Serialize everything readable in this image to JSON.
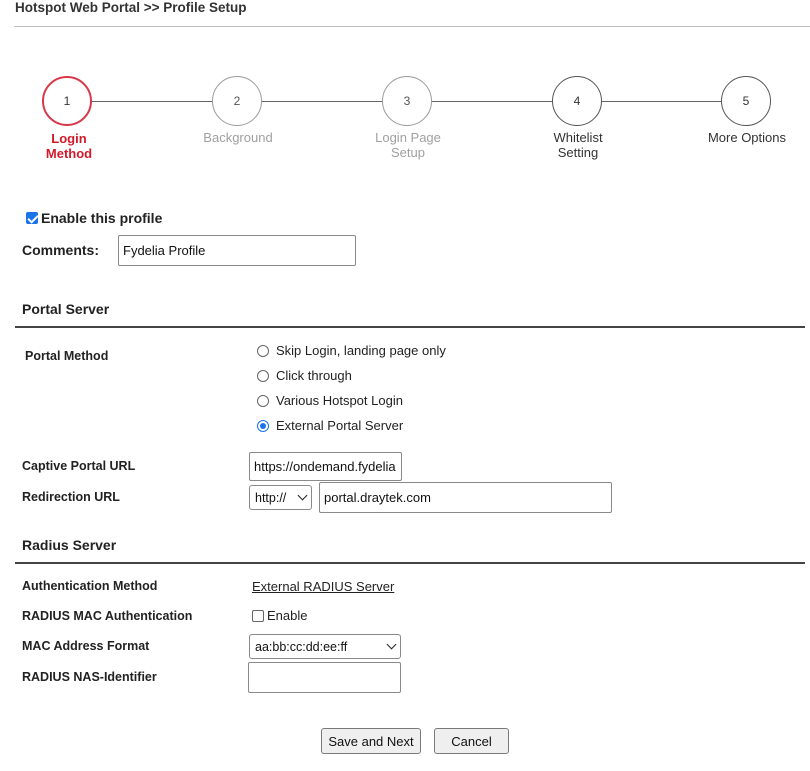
{
  "header": {
    "title": "Hotspot Web Portal >> Profile Setup"
  },
  "steps": [
    {
      "number": "1",
      "label_line1": "Login",
      "label_line2": "Method",
      "state": "active"
    },
    {
      "number": "2",
      "label_line1": "Background",
      "label_line2": "",
      "state": "inactive"
    },
    {
      "number": "3",
      "label_line1": "Login Page",
      "label_line2": "Setup",
      "state": "inactive"
    },
    {
      "number": "4",
      "label_line1": "Whitelist",
      "label_line2": "Setting",
      "state": "normal"
    },
    {
      "number": "5",
      "label_line1": "More Options",
      "label_line2": "",
      "state": "normal"
    }
  ],
  "profile": {
    "enable_label": "Enable this profile",
    "enable_checked": true,
    "comments_label": "Comments:",
    "comments_value": "Fydelia Profile"
  },
  "portal_server": {
    "section_title": "Portal Server",
    "method_label": "Portal Method",
    "options": [
      {
        "label": "Skip Login, landing page only",
        "checked": false
      },
      {
        "label": "Click through",
        "checked": false
      },
      {
        "label": "Various Hotspot Login",
        "checked": false
      },
      {
        "label": "External Portal Server",
        "checked": true
      }
    ],
    "captive_url_label": "Captive Portal URL",
    "captive_url_value": "https://ondemand.fydelia",
    "redirection_label": "Redirection URL",
    "redirection_protocol": "http://",
    "redirection_value": "portal.draytek.com"
  },
  "radius_server": {
    "section_title": "Radius Server",
    "auth_method_label": "Authentication Method",
    "auth_method_value": "External RADIUS Server",
    "mac_auth_label": "RADIUS MAC Authentication",
    "mac_auth_option": "Enable",
    "mac_auth_checked": false,
    "mac_format_label": "MAC Address Format",
    "mac_format_value": "aa:bb:cc:dd:ee:ff",
    "nas_identifier_label": "RADIUS NAS-Identifier",
    "nas_identifier_value": ""
  },
  "buttons": {
    "save_next": "Save and Next",
    "cancel": "Cancel"
  },
  "colors": {
    "active_step": "#d11a2a",
    "inactive_step": "#a0a0a0",
    "radio_checked": "#1a73e8"
  }
}
